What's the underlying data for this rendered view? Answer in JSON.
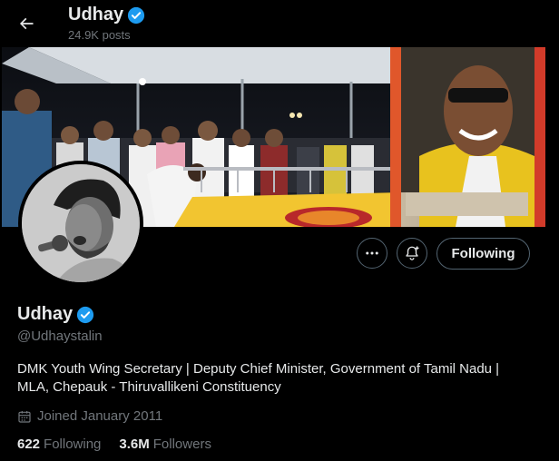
{
  "header": {
    "name": "Udhay",
    "posts": "24.9K posts"
  },
  "profile": {
    "name": "Udhay",
    "handle": "@Udhaystalin",
    "bio": "DMK Youth Wing Secretary | Deputy Chief Minister, Government of Tamil Nadu | MLA, Chepauk - Thiruvallikeni Constituency",
    "joined": "Joined January 2011",
    "following_count": "622",
    "following_label": "Following",
    "followers_count": "3.6M",
    "followers_label": "Followers"
  },
  "actions": {
    "following_button": "Following"
  },
  "colors": {
    "background": "#000000",
    "verified": "#1d9bf0",
    "text_primary": "#e7e9ea",
    "text_secondary": "#71767b"
  },
  "icons": [
    "back-arrow-icon",
    "verified-badge-icon",
    "more-icon",
    "notification-bell-icon",
    "calendar-icon"
  ]
}
